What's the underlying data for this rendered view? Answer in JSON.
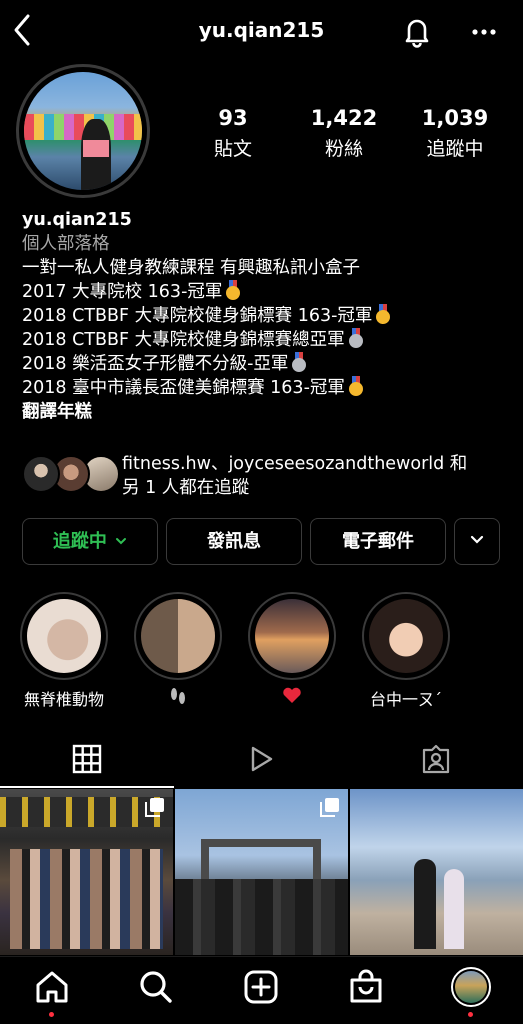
{
  "header": {
    "username": "yu.qian215"
  },
  "stats": [
    {
      "count": "93",
      "label": "貼文"
    },
    {
      "count": "1,422",
      "label": "粉絲"
    },
    {
      "count": "1,039",
      "label": "追蹤中"
    }
  ],
  "bio": {
    "name": "yu.qian215",
    "category": "個人部落格",
    "lines": [
      {
        "text": "一對一私人健身教練課程 有興趣私訊小盒子",
        "medal": ""
      },
      {
        "text": "2017 大專院校 163-冠軍",
        "medal": "gold"
      },
      {
        "text": "2018 CTBBF 大專院校健身錦標賽 163-冠軍",
        "medal": "gold"
      },
      {
        "text": "2018 CTBBF 大專院校健身錦標賽總亞軍",
        "medal": "silver"
      },
      {
        "text": "2018 樂活盃女子形體不分級-亞軍",
        "medal": "silver"
      },
      {
        "text": "2018 臺中市議長盃健美錦標賽 163-冠軍",
        "medal": "gold"
      }
    ],
    "translate": "翻譯年糕"
  },
  "followed_by": {
    "line1": "fitness.hw、joyceseesozandtheworld 和",
    "line2": "另 1 人都在追蹤"
  },
  "buttons": {
    "following": "追蹤中",
    "message": "發訊息",
    "email": "電子郵件"
  },
  "highlights": [
    {
      "label": "無脊椎動物"
    },
    {
      "label": ""
    },
    {
      "label": ""
    },
    {
      "label": "台中一ㄡˊ"
    }
  ],
  "colors": {
    "following_green": "#2fbf54",
    "notification_dot": "#ff3040",
    "border": "#3a3a3a"
  },
  "icons": {
    "back": "chevron-left-icon",
    "notifications": "bell-icon",
    "more": "more-horizontal-icon",
    "tabs": [
      "grid-icon",
      "reels-play-icon",
      "tagged-icon"
    ],
    "nav": [
      "home-icon",
      "search-icon",
      "create-icon",
      "shop-icon",
      "profile-avatar"
    ]
  }
}
